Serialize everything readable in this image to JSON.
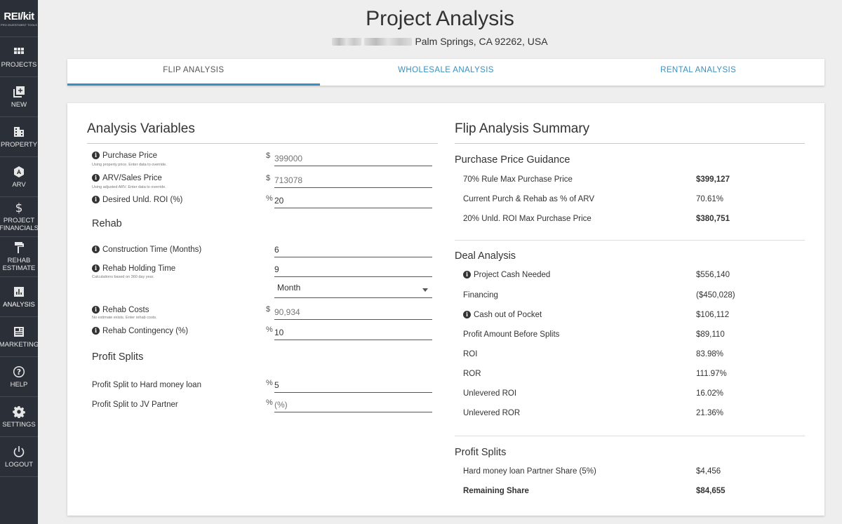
{
  "app": {
    "logo": "REI/kit",
    "logo_sub": "PRO INVESTMENT TOOLS"
  },
  "nav": [
    {
      "label": "PROJECTS",
      "icon": "grid-icon"
    },
    {
      "label": "NEW",
      "icon": "add-box-icon"
    },
    {
      "label": "PROPERTY",
      "icon": "building-icon"
    },
    {
      "label": "ARV",
      "icon": "arv-icon"
    },
    {
      "label": "PROJECT FINANCIALS",
      "icon": "dollar-icon"
    },
    {
      "label": "REHAB ESTIMATE",
      "icon": "paint-roller-icon"
    },
    {
      "label": "ANALYSIS",
      "icon": "bar-chart-icon"
    },
    {
      "label": "MARKETING",
      "icon": "newspaper-icon"
    },
    {
      "label": "HELP",
      "icon": "help-icon"
    },
    {
      "label": "SETTINGS",
      "icon": "gear-icon"
    },
    {
      "label": "LOGOUT",
      "icon": "power-icon"
    }
  ],
  "header": {
    "title": "Project Analysis",
    "address": "Palm Springs, CA 92262, USA"
  },
  "tabs": [
    {
      "label": "FLIP ANALYSIS",
      "active": true
    },
    {
      "label": "WHOLESALE ANALYSIS",
      "active": false
    },
    {
      "label": "RENTAL ANALYSIS",
      "active": false
    }
  ],
  "variables": {
    "title": "Analysis Variables",
    "purchase_price": {
      "label": "Purchase Price",
      "note": "Using property price. Enter data to override.",
      "unit": "$",
      "placeholder": "399000"
    },
    "arv_price": {
      "label": "ARV/Sales Price",
      "note": "Using adjusted ARV. Enter data to override.",
      "unit": "$",
      "placeholder": "713078"
    },
    "desired_roi": {
      "label": "Desired Unld. ROI (%)",
      "unit": "%",
      "value": "20"
    },
    "rehab_title": "Rehab",
    "construction_time": {
      "label": "Construction Time (Months)",
      "value": "6"
    },
    "holding_time": {
      "label": "Rehab Holding Time",
      "note": "Calculations based on 360 day year.",
      "value": "9"
    },
    "holding_unit": "Month",
    "rehab_costs": {
      "label": "Rehab Costs",
      "note": "No estimate exists. Enter rehab costs.",
      "unit": "$",
      "placeholder": "90,934"
    },
    "rehab_contingency": {
      "label": "Rehab Contingency (%)",
      "unit": "%",
      "value": "10"
    },
    "splits_title": "Profit Splits",
    "split_hard_money": {
      "label": "Profit Split to Hard money loan",
      "unit": "%",
      "value": "5"
    },
    "split_jv": {
      "label": "Profit Split to JV Partner",
      "unit": "%",
      "placeholder": "(%)"
    }
  },
  "summary": {
    "title": "Flip Analysis Summary",
    "guidance_title": "Purchase Price Guidance",
    "guidance": [
      {
        "label": "70% Rule Max Purchase Price",
        "value": "$399,127",
        "bold": true
      },
      {
        "label": "Current Purch & Rehab as % of ARV",
        "value": "70.61%",
        "bold": false
      },
      {
        "label": "20% Unld. ROI Max Purchase Price",
        "value": "$380,751",
        "bold": true
      }
    ],
    "deal_title": "Deal Analysis",
    "deal": [
      {
        "label": "Project Cash Needed",
        "value": "$556,140",
        "info": true
      },
      {
        "label": "Financing",
        "value": "($450,028)",
        "info": false
      },
      {
        "label": "Cash out of Pocket",
        "value": "$106,112",
        "info": true
      },
      {
        "label": "Profit Amount Before Splits",
        "value": "$89,110",
        "info": false
      },
      {
        "label": "ROI",
        "value": "83.98%",
        "info": false
      },
      {
        "label": "ROR",
        "value": "111.97%",
        "info": false
      },
      {
        "label": "Unlevered ROI",
        "value": "16.02%",
        "info": false
      },
      {
        "label": "Unlevered ROR",
        "value": "21.36%",
        "info": false
      }
    ],
    "splits_title": "Profit Splits",
    "splits": [
      {
        "label": "Hard money loan Partner Share (5%)",
        "value": "$4,456",
        "bold": false
      },
      {
        "label": "Remaining Share",
        "value": "$84,655",
        "bold": true
      }
    ]
  }
}
